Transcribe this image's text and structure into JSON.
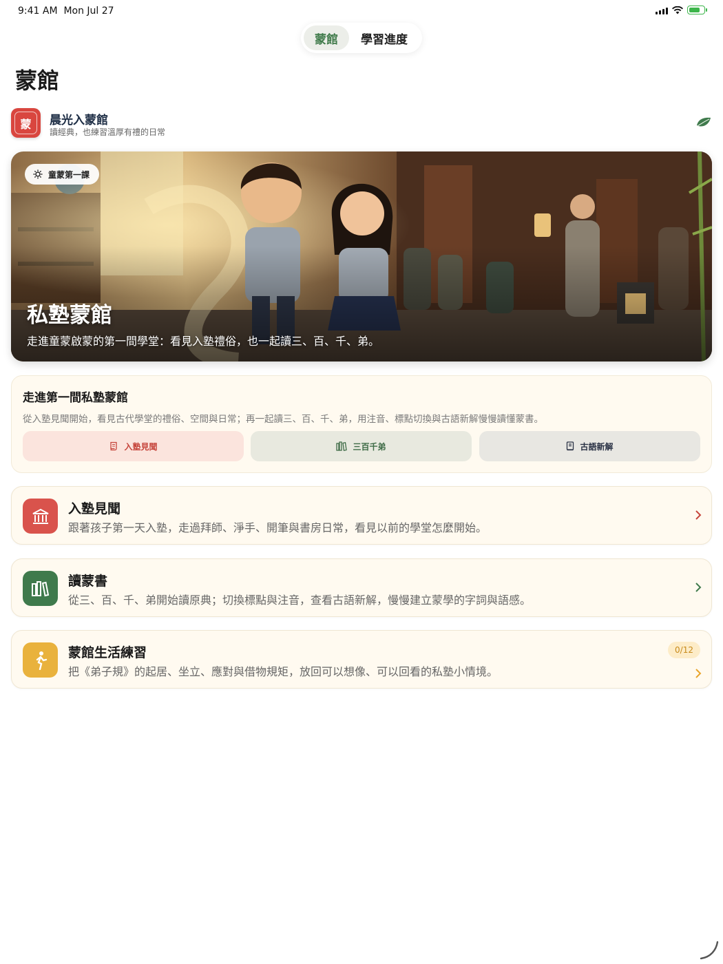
{
  "status": {
    "time": "9:41 AM",
    "date": "Mon Jul 27"
  },
  "nav": {
    "tab_active": "蒙館",
    "tab_other": "學習進度"
  },
  "page_title": "蒙館",
  "brand": {
    "icon_char": "蒙",
    "name": "晨光入蒙館",
    "subtitle": "讀經典，也練習溫厚有禮的日常"
  },
  "hero": {
    "badge": "童蒙第一課",
    "title": "私塾蒙館",
    "subtitle": "走進童蒙啟蒙的第一間學堂：看見入塾禮俗，也一起讀三、百、千、弟。"
  },
  "intro": {
    "title": "走進第一間私塾蒙館",
    "description": "從入塾見聞開始，看見古代學堂的禮俗、空間與日常；再一起讀三、百、千、弟，用注音、標點切換與古語新解慢慢讀懂蒙書。",
    "buttons": [
      "入塾見聞",
      "三百千弟",
      "古語新解"
    ]
  },
  "sections": [
    {
      "title": "入塾見聞",
      "description": "跟著孩子第一天入塾，走過拜師、淨手、開筆與書房日常，看見以前的學堂怎麼開始。",
      "icon": "temple-icon",
      "color": "#d9534c"
    },
    {
      "title": "讀蒙書",
      "description": "從三、百、千、弟開始讀原典；切換標點與注音，查看古語新解，慢慢建立蒙學的字詞與語感。",
      "icon": "books-icon",
      "color": "#3f7a4c"
    },
    {
      "title": "蒙館生活練習",
      "description": "把《弟子規》的起居、坐立、應對與借物規矩，放回可以想像、可以回看的私塾小情境。",
      "icon": "walking-person-icon",
      "color": "#e9b23d",
      "badge": "0/12"
    }
  ]
}
